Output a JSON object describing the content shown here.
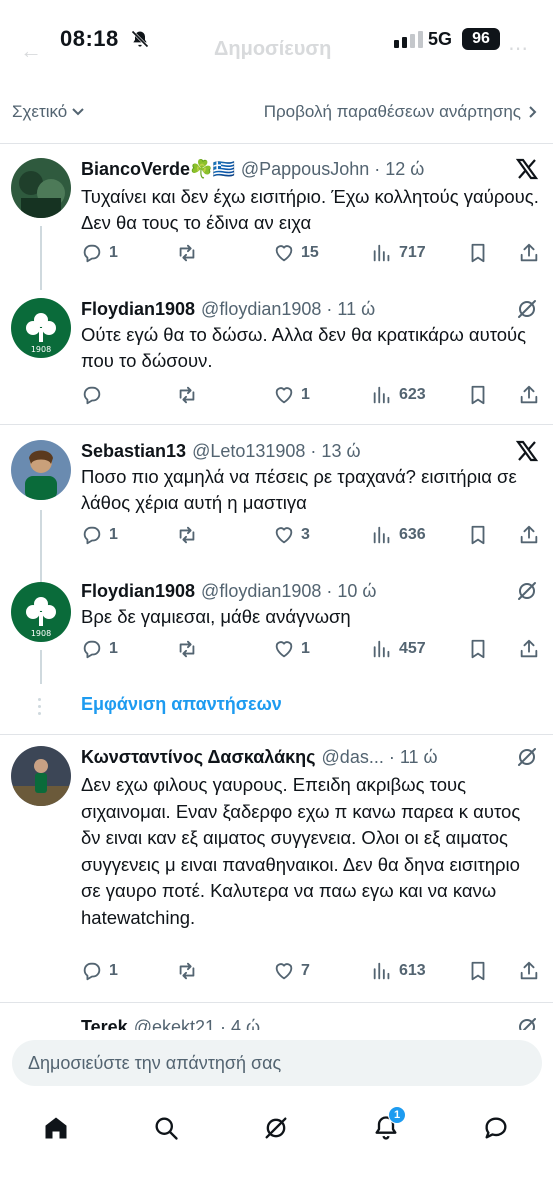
{
  "status_bar": {
    "time": "08:18",
    "network": "5G",
    "battery": "96"
  },
  "header": {
    "ghost_title": "Δημοσίευση"
  },
  "filter": {
    "relevant_label": "Σχετικό",
    "quotes_label": "Προβολή παραθέσεων ανάρτησης"
  },
  "tweets": [
    {
      "name": "BiancoVerde☘️🇬🇷",
      "handle": "@PappousJohn · 12 ώ",
      "text": "Τυχαίνει και δεν έχω εισιτήριο. Έχω κολλητούς γαύρους. Δεν θα τους το έδινα αν ειχα",
      "replies": "1",
      "reposts": "",
      "likes": "15",
      "views": "717",
      "corner_icon": "x-logo-icon"
    },
    {
      "name": "Floydian1908",
      "handle": "@floydian1908 · 11 ώ",
      "text": "Ούτε εγώ θα το δώσω. Αλλα δεν θα κρατικάρω αυτούς που το δώσουν.",
      "replies": "",
      "reposts": "",
      "likes": "1",
      "views": "623",
      "corner_icon": "grok-icon"
    },
    {
      "name": "Sebastian13",
      "handle": "@Leto131908 · 13 ώ",
      "text": "Ποσο πιο χαμηλά να πέσεις ρε τραχανά? εισιτήρια σε λάθος χέρια αυτή η μαστιγα",
      "replies": "1",
      "reposts": "",
      "likes": "3",
      "views": "636",
      "corner_icon": "x-logo-icon"
    },
    {
      "name": "Floydian1908",
      "handle": "@floydian1908 · 10 ώ",
      "text": "Βρε δε γαμιεσαι, μάθε ανάγνωση",
      "replies": "1",
      "reposts": "",
      "likes": "1",
      "views": "457",
      "corner_icon": "grok-icon"
    },
    {
      "name": "Κωνσταντίνος Δασκαλάκης",
      "handle": "@das... · 11 ώ",
      "text": "Δεν εχω φιλους γαυρους. Επειδη ακριβως τους σιχαινομαι. Εναν ξαδερφο εχω π κανω παρεα κ αυτος δν ειναι καν εξ αιματος συγγενεια. Ολοι οι εξ αιματος συγγενεις μ ειναι παναθηναικοι. Δεν θα δηνα εισιτηριο σε γαυρο ποτέ. Καλυτερα να παω εγω και να κανω hatewatching.",
      "replies": "1",
      "reposts": "",
      "likes": "7",
      "views": "613",
      "corner_icon": "grok-icon"
    },
    {
      "name": "Terek",
      "handle": "@ekekt21 · 4 ώ",
      "corner_icon": "grok-icon"
    }
  ],
  "show_replies": "Εμφάνιση απαντήσεων",
  "reply_bar": {
    "placeholder": "Δημοσιεύστε την απάντησή σας"
  },
  "nav": {
    "notifications_badge": "1"
  },
  "colors": {
    "accent": "#1d9bf0",
    "text": "#0f1419",
    "muted": "#536471",
    "green": "#0a6b3a"
  }
}
